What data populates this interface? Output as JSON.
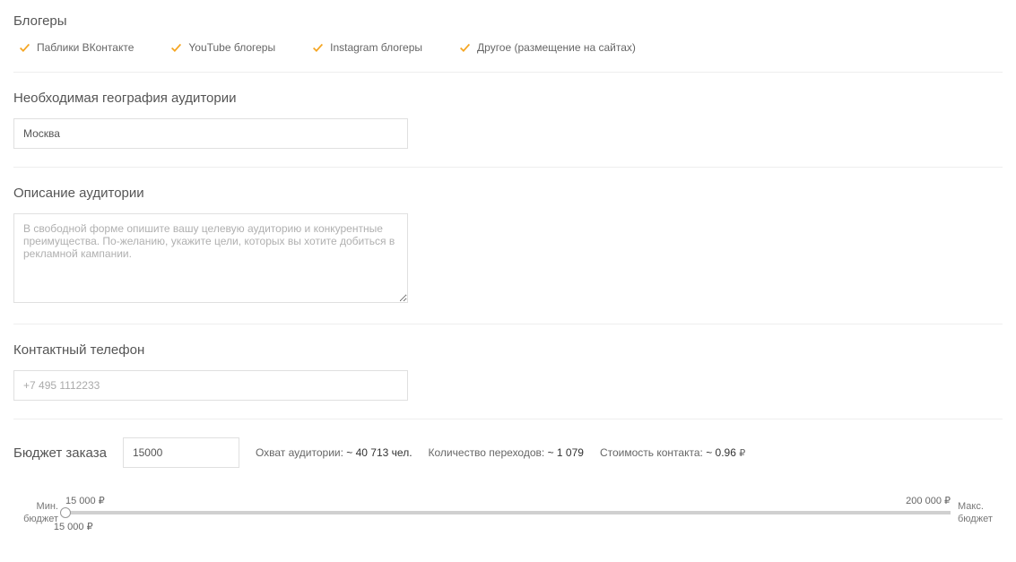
{
  "bloggers": {
    "title": "Блогеры",
    "options": [
      {
        "label": "Паблики ВКонтакте",
        "checked": true
      },
      {
        "label": "YouTube блогеры",
        "checked": true
      },
      {
        "label": "Instagram блогеры",
        "checked": true
      },
      {
        "label": "Другое (размещение на сайтах)",
        "checked": true
      }
    ]
  },
  "geography": {
    "title": "Необходимая география аудитории",
    "value": "Москва"
  },
  "audience": {
    "title": "Описание аудитории",
    "placeholder": "В свободной форме опишите вашу целевую аудиторию и конкурентные преимущества. По-желанию, укажите цели, которых вы хотите добиться в рекламной кампании."
  },
  "phone": {
    "title": "Контактный телефон",
    "placeholder": "+7 495 1112233"
  },
  "budget": {
    "title": "Бюджет заказа",
    "value": "15000",
    "metrics": {
      "reach_label": "Охват аудитории:",
      "reach_value": "~ 40 713 чел.",
      "clicks_label": "Количество переходов:",
      "clicks_value": "~ 1 079",
      "cost_label": "Стоимость контакта:",
      "cost_value": "~ 0.96"
    },
    "slider": {
      "min_label": "Мин. бюджет",
      "max_label": "Макс. бюджет",
      "min_value": "15 000",
      "max_value": "200 000",
      "current_value": "15 000"
    }
  },
  "currency": "₽"
}
